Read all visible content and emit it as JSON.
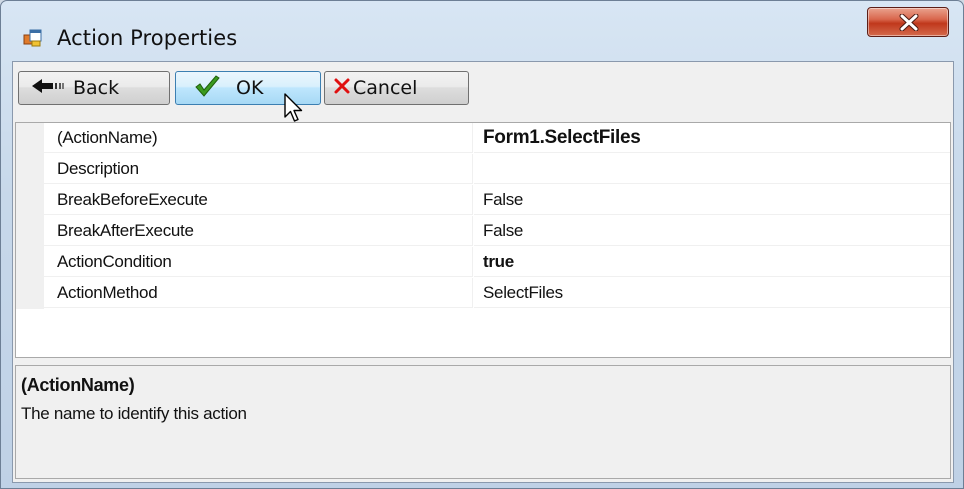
{
  "window": {
    "title": "Action Properties",
    "title_icon": "form-icon",
    "close_icon": "close-icon",
    "accent_close": "#c0381c"
  },
  "toolbar": {
    "back_label": "Back",
    "back_icon": "back-arrow-icon",
    "ok_label": "OK",
    "ok_icon": "checkmark-icon",
    "cancel_label": "Cancel",
    "cancel_icon": "red-x-icon"
  },
  "properties": [
    {
      "name": "(ActionName)",
      "value": "Form1.SelectFiles",
      "bold": true
    },
    {
      "name": "Description",
      "value": "",
      "bold": false
    },
    {
      "name": "BreakBeforeExecute",
      "value": "False",
      "bold": false
    },
    {
      "name": "BreakAfterExecute",
      "value": "False",
      "bold": false
    },
    {
      "name": "ActionCondition",
      "value": "true",
      "bold": true
    },
    {
      "name": "ActionMethod",
      "value": "SelectFiles",
      "bold": false
    }
  ],
  "description": {
    "title": "(ActionName)",
    "text": "The name to identify this action"
  }
}
